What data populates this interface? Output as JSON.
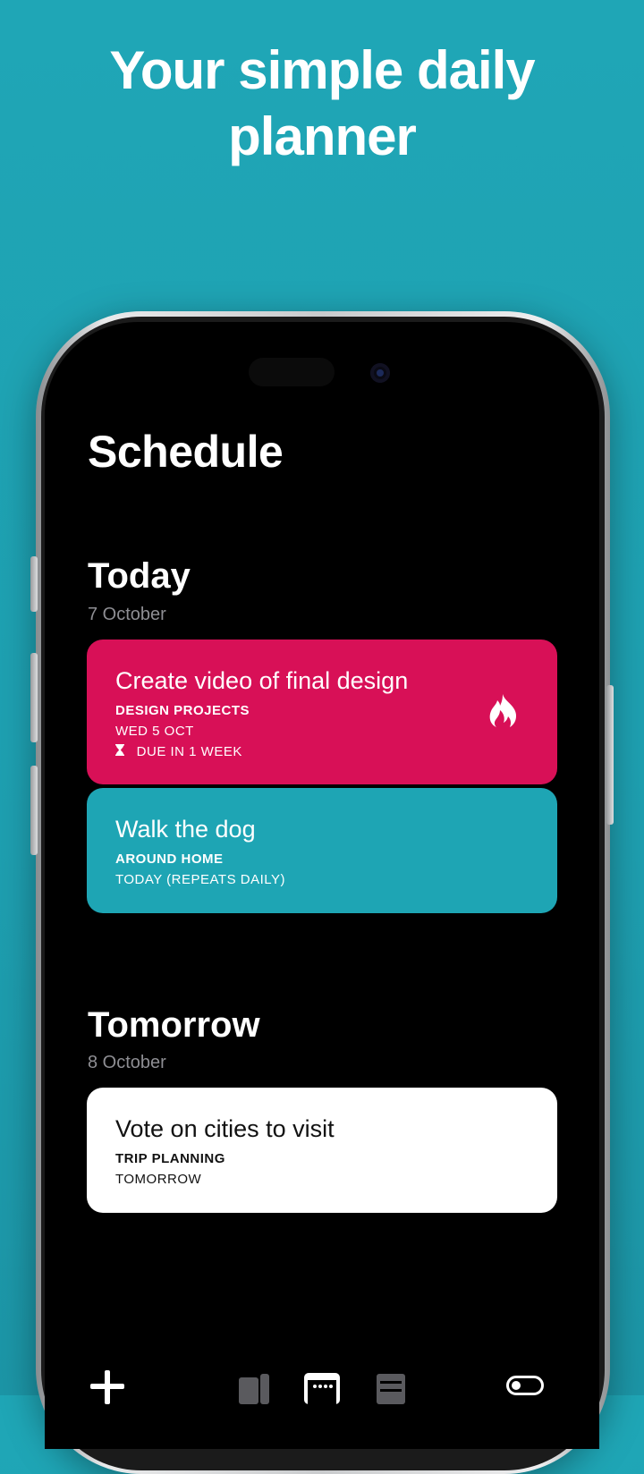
{
  "headline": {
    "line1": "Your simple daily",
    "line2": "planner"
  },
  "screen": {
    "title": "Schedule",
    "sections": [
      {
        "title": "Today",
        "date": "7 October",
        "cards": [
          {
            "title": "Create video of final design",
            "project": "DESIGN PROJECTS",
            "date": "WED 5 OCT",
            "due": "DUE IN 1 WEEK",
            "color": "#d81057",
            "icon": "fire-icon"
          },
          {
            "title": "Walk the dog",
            "project": "AROUND HOME",
            "date": "TODAY (REPEATS DAILY)",
            "color": "#1ea5b4"
          }
        ]
      },
      {
        "title": "Tomorrow",
        "date": "8 October",
        "cards": [
          {
            "title": "Vote on cities to visit",
            "project": "TRIP PLANNING",
            "date": "TOMORROW",
            "color": "#ffffff"
          }
        ]
      }
    ]
  },
  "tabbar": {
    "icons": [
      "plus-icon",
      "projects-icon",
      "calendar-icon",
      "list-icon",
      "toggle-icon"
    ]
  },
  "colors": {
    "background": "#1fa6b6",
    "accent_red": "#d81057",
    "accent_teal": "#1ea5b4"
  }
}
